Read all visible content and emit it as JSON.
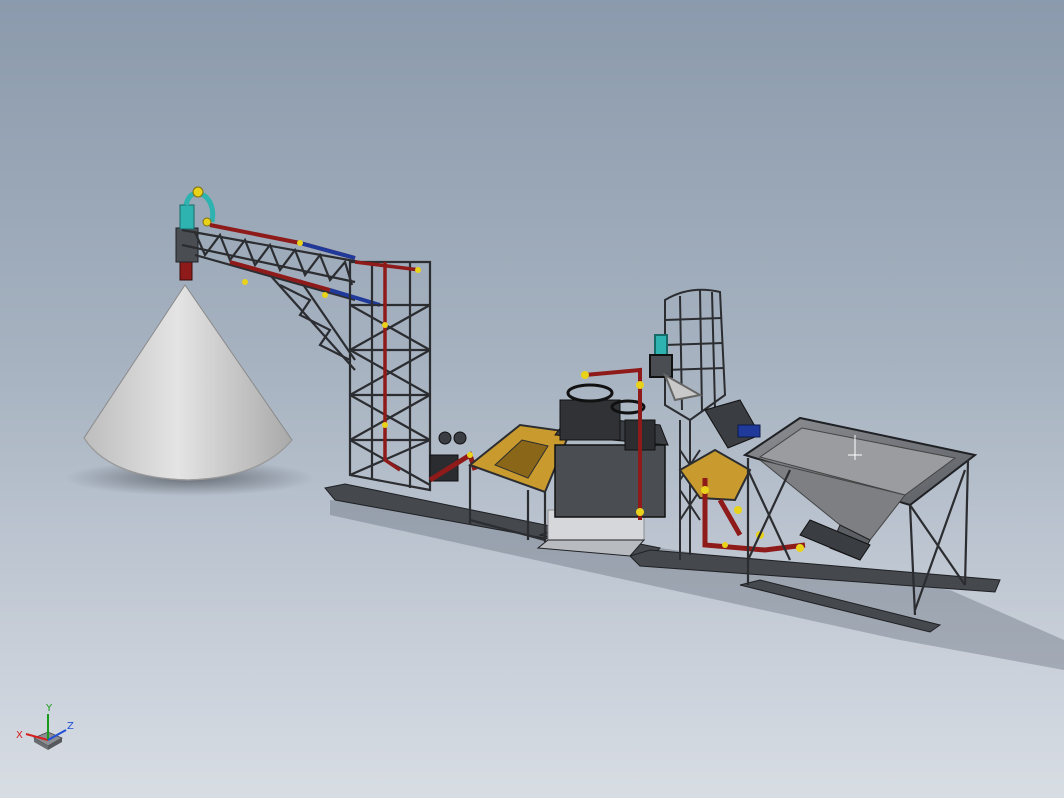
{
  "viewport": {
    "background_top": "#8b9aac",
    "background_bottom": "#d8dde4"
  },
  "model": {
    "components": [
      "cone-stockpile",
      "discharge-nozzle",
      "conveyor-boom-truss",
      "support-tower",
      "feed-hopper",
      "crusher-unit",
      "ladder-cage-tower",
      "secondary-hopper",
      "receiving-bin",
      "skid-base"
    ],
    "colors": {
      "steel": "#3a3d42",
      "pipe_red": "#8e1a1a",
      "pipe_blue": "#1f3a9a",
      "joint_yellow": "#e8d21a",
      "valve_teal": "#2fb3b0",
      "hopper_gold": "#c99a2e",
      "cone_grey": "#d4d4d4"
    }
  },
  "triad": {
    "x_label": "X",
    "y_label": "Y",
    "z_label": "Z",
    "x_color": "#d62020",
    "y_color": "#1a9a1a",
    "z_color": "#1f4fd6"
  }
}
